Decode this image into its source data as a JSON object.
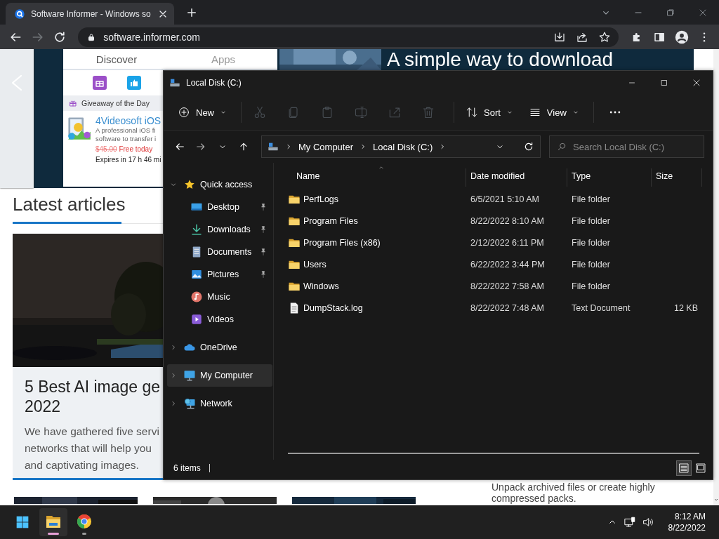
{
  "browser": {
    "tabs": [
      {
        "title": "Software Informer - Windows so",
        "selected": true
      }
    ],
    "url": "software.informer.com"
  },
  "webpage": {
    "headline": "A simple way to download",
    "widget": {
      "title": "Discover",
      "tab": "Apps",
      "giveaway": "Giveaway of the Day",
      "app_name": "4Videosoft iOS",
      "app_description_lines": [
        "A professional iOS fi",
        "software to transfer i"
      ],
      "price": "$45.00",
      "offer": "Free today",
      "expires": "Expires in 17 h 46 mi"
    },
    "section_title": "Latest articles",
    "article": {
      "title_lines": [
        "5 Best AI image ge",
        "2022"
      ],
      "excerpt_lines": [
        "We have gathered five servi",
        "networks that will help you",
        "and captivating images."
      ]
    },
    "side_text_lines": [
      "Unpack archived files or create highly",
      "compressed packs."
    ]
  },
  "explorer": {
    "title": "Local Disk (C:)",
    "toolbar": {
      "new_label": "New",
      "actions": [
        {
          "disabled": true
        },
        {
          "disabled": true
        },
        {
          "disabled": true
        },
        {
          "disabled": true
        },
        {
          "disabled": true
        },
        {
          "disabled": true
        }
      ],
      "sort_label": "Sort",
      "view_label": "View"
    },
    "breadcrumbs": [
      "My Computer",
      "Local Disk (C:)"
    ],
    "search": {
      "placeholder": "Search Local Disk (C:)"
    },
    "sidebar": [
      {
        "label": "Quick access",
        "kind": "star",
        "expanded": true,
        "selected": false,
        "children": [
          {
            "label": "Desktop",
            "kind": "desktop",
            "pinned": true,
            "selected": false
          },
          {
            "label": "Downloads",
            "kind": "download",
            "pinned": true,
            "selected": false
          },
          {
            "label": "Documents",
            "kind": "document",
            "pinned": true,
            "selected": false
          },
          {
            "label": "Pictures",
            "kind": "picture",
            "pinned": true,
            "selected": false
          },
          {
            "label": "Music",
            "kind": "music",
            "pinned": false,
            "selected": false
          },
          {
            "label": "Videos",
            "kind": "video",
            "pinned": false,
            "selected": false
          }
        ]
      },
      {
        "label": "OneDrive",
        "kind": "cloud",
        "expanded": false,
        "selected": false
      },
      {
        "label": "My Computer",
        "kind": "computer",
        "expanded": false,
        "selected": true
      },
      {
        "label": "Network",
        "kind": "network",
        "expanded": false,
        "selected": false
      }
    ],
    "columns": [
      {
        "label": "Name",
        "sorted": true
      },
      {
        "label": "Date modified",
        "sorted": false
      },
      {
        "label": "Type",
        "sorted": false
      },
      {
        "label": "Size",
        "sorted": false
      }
    ],
    "rows": [
      {
        "kind": "folder",
        "name": "PerfLogs",
        "date": "6/5/2021 5:10 AM",
        "type": "File folder"
      },
      {
        "kind": "folder",
        "name": "Program Files",
        "date": "8/22/2022 8:10 AM",
        "type": "File folder"
      },
      {
        "kind": "folder",
        "name": "Program Files (x86)",
        "date": "2/12/2022 6:11 PM",
        "type": "File folder"
      },
      {
        "kind": "folder",
        "name": "Users",
        "date": "6/22/2022 3:44 PM",
        "type": "File folder"
      },
      {
        "kind": "folder",
        "name": "Windows",
        "date": "8/22/2022 7:58 AM",
        "type": "File folder"
      },
      {
        "kind": "file",
        "name": "DumpStack.log",
        "date": "8/22/2022 7:48 AM",
        "type": "Text Document",
        "size": "12 KB"
      }
    ],
    "status": "6 items",
    "view_modes": [
      {
        "kind": "details",
        "selected": true
      },
      {
        "kind": "tiles",
        "selected": false
      }
    ]
  },
  "taskbar": {
    "apps": [
      {
        "kind": "explorer",
        "active": true
      },
      {
        "kind": "browser",
        "active": false
      }
    ],
    "time": "8:12 AM",
    "date": "8/22/2022"
  }
}
